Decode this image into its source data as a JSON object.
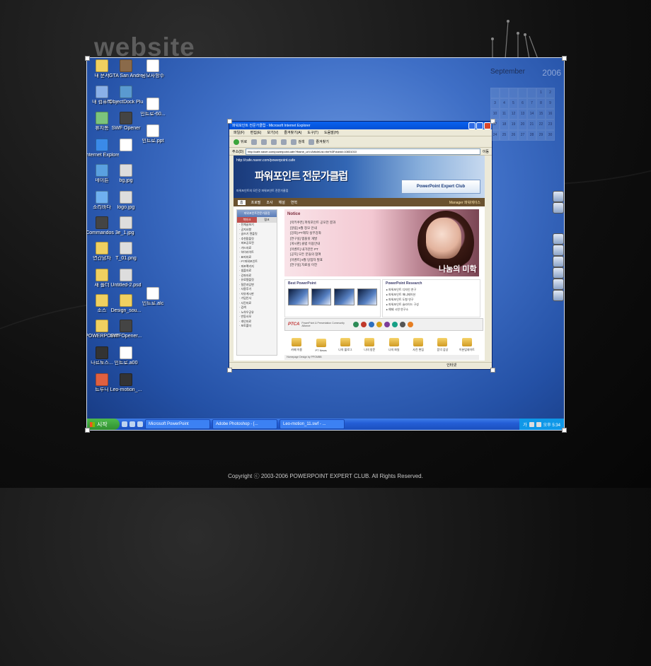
{
  "brand": {
    "title": "website"
  },
  "copyright": "Copyright ⓒ 2003-2006 POWERPOINT EXPERT CLUB. All Rights Reserved.",
  "colors": {
    "accent": "#2451a6",
    "taskbar": "#245ed6",
    "start": "#2f8f2f"
  },
  "calendar": {
    "month": "September",
    "year": "2006",
    "days": [
      "",
      "",
      "",
      "",
      "",
      "1",
      "2",
      "3",
      "4",
      "5",
      "6",
      "7",
      "8",
      "9",
      "10",
      "11",
      "12",
      "13",
      "14",
      "15",
      "16",
      "17",
      "18",
      "19",
      "20",
      "21",
      "22",
      "23",
      "24",
      "25",
      "26",
      "27",
      "28",
      "29",
      "30"
    ]
  },
  "desktop_icons": [
    {
      "label": "내 문서",
      "icon": "folder-icon",
      "color": "#f0d060"
    },
    {
      "label": "내 컴퓨터",
      "icon": "computer-icon",
      "color": "#8ab0e8"
    },
    {
      "label": "휴지통",
      "icon": "recycle-bin-icon",
      "color": "#7cc47c"
    },
    {
      "label": "Internet Explorer",
      "icon": "ie-icon",
      "color": "#3a8ae8"
    },
    {
      "label": "네이튼",
      "icon": "nateon-icon",
      "color": "#5aa0e0"
    },
    {
      "label": "소리바다",
      "icon": "soribada-icon",
      "color": "#6fb0f0"
    },
    {
      "label": "Commandos 3",
      "icon": "game-icon",
      "color": "#444444"
    },
    {
      "label": "연간남자",
      "icon": "folder-icon",
      "color": "#f0d060"
    },
    {
      "label": "새 폴더",
      "icon": "folder-icon",
      "color": "#f0d060"
    },
    {
      "label": "소스",
      "icon": "folder-icon",
      "color": "#f0d060"
    },
    {
      "label": "POWERPOINT",
      "icon": "folder-icon",
      "color": "#f0d060"
    },
    {
      "label": "나르토스...",
      "icon": "movie-icon",
      "color": "#333333"
    },
    {
      "label": "트루니",
      "icon": "truenie-icon",
      "color": "#e06040"
    },
    {
      "label": "GTA San Andreas",
      "icon": "gta-icon",
      "color": "#8a6a4a"
    },
    {
      "label": "ObjectDock Plus 1.0...",
      "icon": "dock-icon",
      "color": "#5a9ad0"
    },
    {
      "label": "SWF Opener",
      "icon": "swf-icon",
      "color": "#444444"
    },
    {
      "label": "",
      "icon": "doc-icon",
      "color": "#ffffff"
    },
    {
      "label": "bg.jpg",
      "icon": "image-file-icon",
      "color": "#dddddd"
    },
    {
      "label": "logo.jpg",
      "icon": "image-file-icon",
      "color": "#dddddd"
    },
    {
      "label": "e_1.jpg",
      "icon": "image-file-icon",
      "color": "#dddddd"
    },
    {
      "label": "T_01.png",
      "icon": "image-file-icon",
      "color": "#dddddd"
    },
    {
      "label": "Untitled-2.psd",
      "icon": "psd-icon",
      "color": "#dddddd"
    },
    {
      "label": "Design_sou...",
      "icon": "folder-icon",
      "color": "#f0d060"
    },
    {
      "label": "SWFOpener...",
      "icon": "swf-icon",
      "color": "#444444"
    },
    {
      "label": "인트로.a00",
      "icon": "file-icon",
      "color": "#ffffff"
    },
    {
      "label": "Leo-motion_...",
      "icon": "movie-icon",
      "color": "#333333"
    },
    {
      "label": "공모사항수",
      "icon": "doc-icon",
      "color": "#ffffff"
    },
    {
      "label": "인트로-60...",
      "icon": "doc-icon",
      "color": "#ffffff"
    },
    {
      "label": "인트로.ppt",
      "icon": "ppt-icon",
      "color": "#ffffff"
    },
    {
      "label": "인트로.alc",
      "icon": "file-icon",
      "color": "#ffffff"
    }
  ],
  "taskbar": {
    "start": "시작",
    "tasks": [
      "Microsoft PowerPoint",
      "Adobe Photoshop - [...",
      "Leo-motion_11.swf - ..."
    ],
    "clock": "오후 5:34",
    "lang": "가"
  },
  "browser": {
    "title": "파워포인트 전문가클럽 - Microsoft Internet Explorer",
    "menu": [
      "파일(F)",
      "편집(E)",
      "보기(V)",
      "즐겨찾기(A)",
      "도구(T)",
      "도움말(H)"
    ],
    "toolbar": {
      "back": "뒤로",
      "search": "검색",
      "favorites": "즐겨찾기"
    },
    "address_label": "주소(D)",
    "url": "http://cafe.naver.com/powerpoint.cafe?iframe_url=/ArticleList.nhn%3Fclubid=10831010",
    "go": "이동",
    "status": "인터넷"
  },
  "site": {
    "cafe_url": "http://cafe.naver.com/powerpoint.cafe",
    "title": "파워포인트 전문가클럽",
    "subtitle": "파워포인트의 모든것 파워포인트 전문가클럽",
    "pe_badge": "PowerPoint Expert Club",
    "nav": [
      "홈",
      "프로필",
      "조사",
      "해설",
      "연혁"
    ],
    "member": "Manager 파워에이스",
    "left": {
      "header": "파워포인트전문가클럽",
      "tabs": [
        "북마크",
        "링크"
      ],
      "items": [
        "전체글보기",
        "공지사항",
        "글쓰기 텐플릿",
        "추천팜플릿",
        "파포공모전",
        "가드자료",
        "하이라이트",
        "표피자료",
        "PT파워포인트",
        "파포팩키지",
        "샘플자료",
        "강좌자료",
        "유료템플릿",
        "질문과답변",
        "사용후기",
        "자유게시판",
        "가입인사",
        "사진자료",
        "검색",
        "노하우공유",
        "반동사모",
        "개인자료",
        "포토폴더"
      ]
    },
    "notice": {
      "heading": "Notice",
      "items": [
        "[럭키쿠폰] 파워포인트 공모전 결과",
        "[알림] 9월 정모 안내",
        "[강좌] PT제작 실무강좌",
        "[연구실] 템플릿 개발",
        "[게시판] 클럽 이용안내",
        "[이벤트] 내가만든 PT",
        "[공지] 모든 분들의 참여",
        "[이벤트] 9월 당첨자 발표",
        "[연구실] 자료실 이전"
      ],
      "tagline": "나눔의 미학"
    },
    "best_pp": "Best PowerPoint",
    "research": {
      "heading": "PowerPoint Research",
      "items": [
        "파워포인트 디자인 연구",
        "파워포인트 애니메이션",
        "파워포인트 도형 연구",
        "파워포인트 슬라이드 구성",
        "예제 시연 연구소"
      ]
    },
    "ptca": {
      "label": "PTCA",
      "text": "PowerPoint & Presentation Community Alliance"
    },
    "bottom": [
      "카페 이용",
      "PT News",
      "나의 블로그",
      "나의 방문",
      "나의 파일",
      "사진 편집",
      "음악 감상",
      "이분업데이트"
    ],
    "footer": "Homepage Design by PPGMBB"
  }
}
